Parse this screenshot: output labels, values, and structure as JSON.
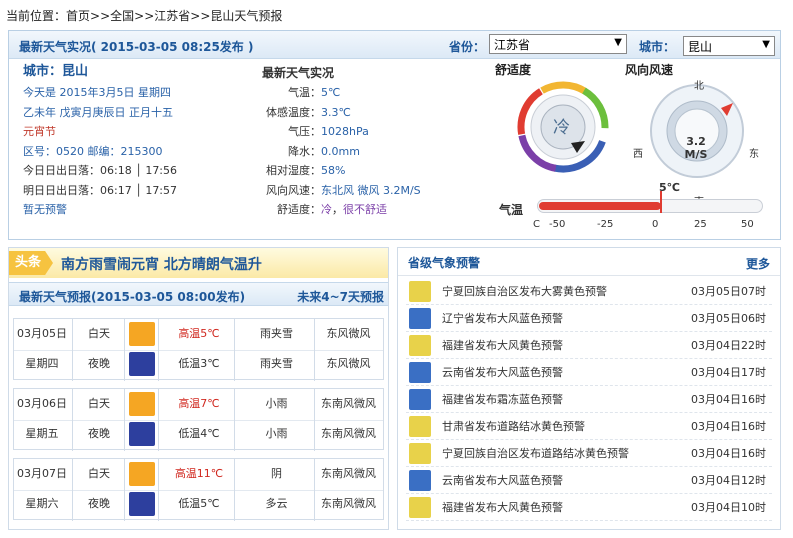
{
  "breadcrumb": {
    "prefix": "当前位置：",
    "home": "首页",
    "sep1": ">>",
    "country": "全国",
    "sep2": ">>",
    "province": "江苏省",
    "sep3": ">>",
    "current": "昆山天气预报"
  },
  "realtime": {
    "header_title": "最新天气实况",
    "header_time": "( 2015-03-05  08:25发布 )",
    "province_label": "省份：",
    "province_value": "江苏省",
    "city_label": "城市：",
    "city_value": "昆山",
    "city_title": "城市：昆山",
    "today": "今天是  2015年3月5日  星期四",
    "lunar": "乙未年  戊寅月庚辰日  正月十五",
    "festival": "元宵节",
    "codes": "区号：0520   邮编：215300",
    "sun_today": "今日日出日落：06:18 │ 17:56",
    "sun_tomorrow": "明日日出日落：06:17 │ 17:57",
    "no_warning": "暂无预警",
    "weather_title": "最新天气实况",
    "items": [
      {
        "label": "气温：",
        "value": "5℃",
        "cls": "blue"
      },
      {
        "label": "体感温度：",
        "value": "3.3℃",
        "cls": "blue"
      },
      {
        "label": "气压：",
        "value": "1028hPa",
        "cls": "blue"
      },
      {
        "label": "降水：",
        "value": "0.0mm",
        "cls": "blue"
      },
      {
        "label": "相对湿度：",
        "value": "58%",
        "cls": "blue"
      },
      {
        "label": "风向风速：",
        "value": "东北风 微风 3.2M/S",
        "cls": "blue"
      }
    ],
    "comfort_label": "舒适度：",
    "comfort_cold": "冷",
    "comfort_sep": "，",
    "comfort_desc": "很不舒适",
    "gauge_comfort_title": "舒适度",
    "gauge_comfort_value": "冷",
    "gauge_wind_title": "风向风速",
    "gauge_wind_value": "3.2",
    "gauge_wind_unit": "M/S",
    "compass": {
      "n": "北",
      "s": "南",
      "e": "东",
      "w": "西"
    },
    "temp_title": "气温",
    "temp_value": "5℃",
    "temp_unit": "C",
    "temp_ticks": [
      "-50",
      "-25",
      "0",
      "25",
      "50"
    ]
  },
  "headline": {
    "tag": "头条",
    "text": "南方雨雪闹元宵  北方晴朗气温升"
  },
  "forecast": {
    "title": "最新天气预报",
    "time": "(2015-03-05  08:00发布)",
    "more": "未来4~7天预报",
    "days": [
      {
        "date": "03月05日",
        "weekday": "星期四",
        "day": {
          "label": "白天",
          "icon": "sleet-icon",
          "temp": "高温5℃",
          "weather": "雨夹雪",
          "wind": "东风微风"
        },
        "night": {
          "label": "夜晚",
          "icon": "sleet-night-icon",
          "temp": "低温3℃",
          "weather": "雨夹雪",
          "wind": "东风微风"
        }
      },
      {
        "date": "03月06日",
        "weekday": "星期五",
        "day": {
          "label": "白天",
          "icon": "light-rain-icon",
          "temp": "高温7℃",
          "weather": "小雨",
          "wind": "东南风微风"
        },
        "night": {
          "label": "夜晚",
          "icon": "light-rain-night-icon",
          "temp": "低温4℃",
          "weather": "小雨",
          "wind": "东南风微风"
        }
      },
      {
        "date": "03月07日",
        "weekday": "星期六",
        "day": {
          "label": "白天",
          "icon": "overcast-icon",
          "temp": "高温11℃",
          "weather": "阴",
          "wind": "东南风微风"
        },
        "night": {
          "label": "夜晚",
          "icon": "cloudy-night-icon",
          "temp": "低温5℃",
          "weather": "多云",
          "wind": "东南风微风"
        }
      }
    ]
  },
  "alerts": {
    "title": "省级气象预警",
    "more": "更多",
    "items": [
      {
        "text": "宁夏回族自治区发布大雾黄色预警",
        "date": "03月05日07时",
        "color": "#e8d24a",
        "icon": "fog-yellow-icon"
      },
      {
        "text": "辽宁省发布大风蓝色预警",
        "date": "03月05日06时",
        "color": "#3a6fc4",
        "icon": "wind-blue-icon"
      },
      {
        "text": "福建省发布大风黄色预警",
        "date": "03月04日22时",
        "color": "#e8d24a",
        "icon": "wind-yellow-icon"
      },
      {
        "text": "云南省发布大风蓝色预警",
        "date": "03月04日17时",
        "color": "#3a6fc4",
        "icon": "wind-blue-icon"
      },
      {
        "text": "福建省发布霜冻蓝色预警",
        "date": "03月04日16时",
        "color": "#3a6fc4",
        "icon": "frost-blue-icon"
      },
      {
        "text": "甘肃省发布道路结冰黄色预警",
        "date": "03月04日16时",
        "color": "#e8d24a",
        "icon": "road-ice-yellow-icon"
      },
      {
        "text": "宁夏回族自治区发布道路结冰黄色预警",
        "date": "03月04日16时",
        "color": "#e8d24a",
        "icon": "road-ice-yellow-icon"
      },
      {
        "text": "云南省发布大风蓝色预警",
        "date": "03月04日12时",
        "color": "#3a6fc4",
        "icon": "wind-blue-icon"
      },
      {
        "text": "福建省发布大风黄色预警",
        "date": "03月04日10时",
        "color": "#e8d24a",
        "icon": "wind-yellow-icon"
      }
    ]
  }
}
